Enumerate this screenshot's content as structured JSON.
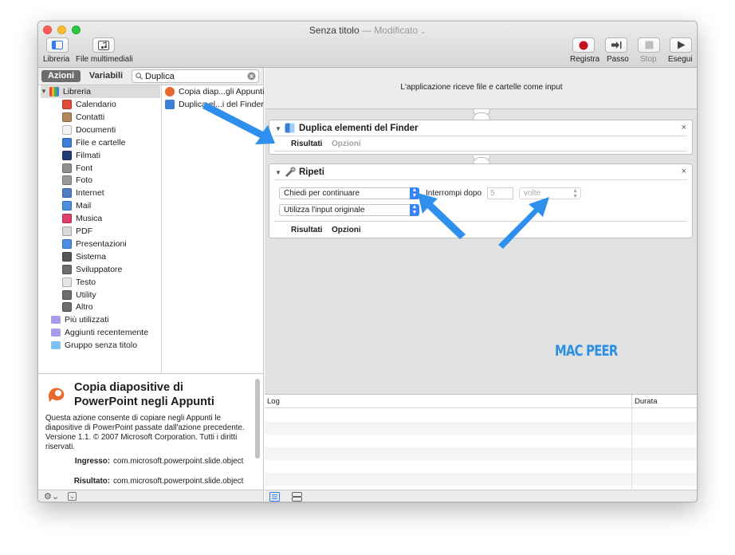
{
  "window": {
    "title": "Senza titolo",
    "title_separator": "—",
    "title_status": "Modificato"
  },
  "toolbar": {
    "library_label": "Libreria",
    "media_label": "File multimediali",
    "record_label": "Registra",
    "step_label": "Passo",
    "stop_label": "Stop",
    "run_label": "Esegui"
  },
  "segments": {
    "actions": "Azioni",
    "variables": "Variabili"
  },
  "search": {
    "value": "Duplica"
  },
  "library": {
    "root": "Libreria",
    "items": [
      {
        "label": "Calendario",
        "color": "#e24b3a"
      },
      {
        "label": "Contatti",
        "color": "#b1895a"
      },
      {
        "label": "Documenti",
        "color": "#f3f3f3"
      },
      {
        "label": "File e cartelle",
        "color": "#3d7fd8"
      },
      {
        "label": "Filmati",
        "color": "#223a73"
      },
      {
        "label": "Font",
        "color": "#8f8f8f"
      },
      {
        "label": "Foto",
        "color": "#9a9a9a"
      },
      {
        "label": "Internet",
        "color": "#4e7dc6"
      },
      {
        "label": "Mail",
        "color": "#4f8fe0"
      },
      {
        "label": "Musica",
        "color": "#e2406b"
      },
      {
        "label": "PDF",
        "color": "#d9d9d9"
      },
      {
        "label": "Presentazioni",
        "color": "#4e8fe3"
      },
      {
        "label": "Sistema",
        "color": "#555555"
      },
      {
        "label": "Sviluppatore",
        "color": "#6d6d6d"
      },
      {
        "label": "Testo",
        "color": "#e6e6e6"
      },
      {
        "label": "Utility",
        "color": "#6d6d6d"
      },
      {
        "label": "Altro",
        "color": "#6d6d6d"
      }
    ],
    "smart": [
      {
        "label": "Più utilizzati",
        "color": "#a99be8"
      },
      {
        "label": "Aggiunti recentemente",
        "color": "#a99be8"
      },
      {
        "label": "Gruppo senza titolo",
        "color": "#7fc0ee"
      }
    ]
  },
  "actions_list": [
    {
      "label": "Copia diap...gli Appunti",
      "color": "#e7672c"
    },
    {
      "label": "Duplica el...i del Finder",
      "color": "#3b7fd6"
    }
  ],
  "description": {
    "title": "Copia diapositive di PowerPoint negli Appunti",
    "text": "Questa azione consente di copiare negli Appunti le diapositive di PowerPoint passate dall'azione precedente. Versione 1.1. © 2007 Microsoft Corporation. Tutti i diritti riservati.",
    "input_label": "Ingresso:",
    "input_value": "com.microsoft.powerpoint.slide.object",
    "result_label": "Risultato:",
    "result_value": "com.microsoft.powerpoint.slide.object"
  },
  "workflow": {
    "header": "L'applicazione riceve file e cartelle come input",
    "action1": {
      "title": "Duplica elementi del Finder",
      "tab_results": "Risultati",
      "tab_options": "Opzioni"
    },
    "action2": {
      "title": "Ripeti",
      "popup_mode": "Chiedi per continuare",
      "stop_after_label": "Interrompi dopo",
      "count_value": "5",
      "unit_value": "volte",
      "input_popup": "Utilizza l'input originale",
      "tab_results": "Risultati",
      "tab_options": "Opzioni"
    }
  },
  "log": {
    "col_log": "Log",
    "col_duration": "Durata"
  },
  "watermark": "MAC PEER",
  "colors": {
    "accent": "#3b82f6",
    "arrow": "#2f8fec",
    "record": "#c4101c"
  }
}
